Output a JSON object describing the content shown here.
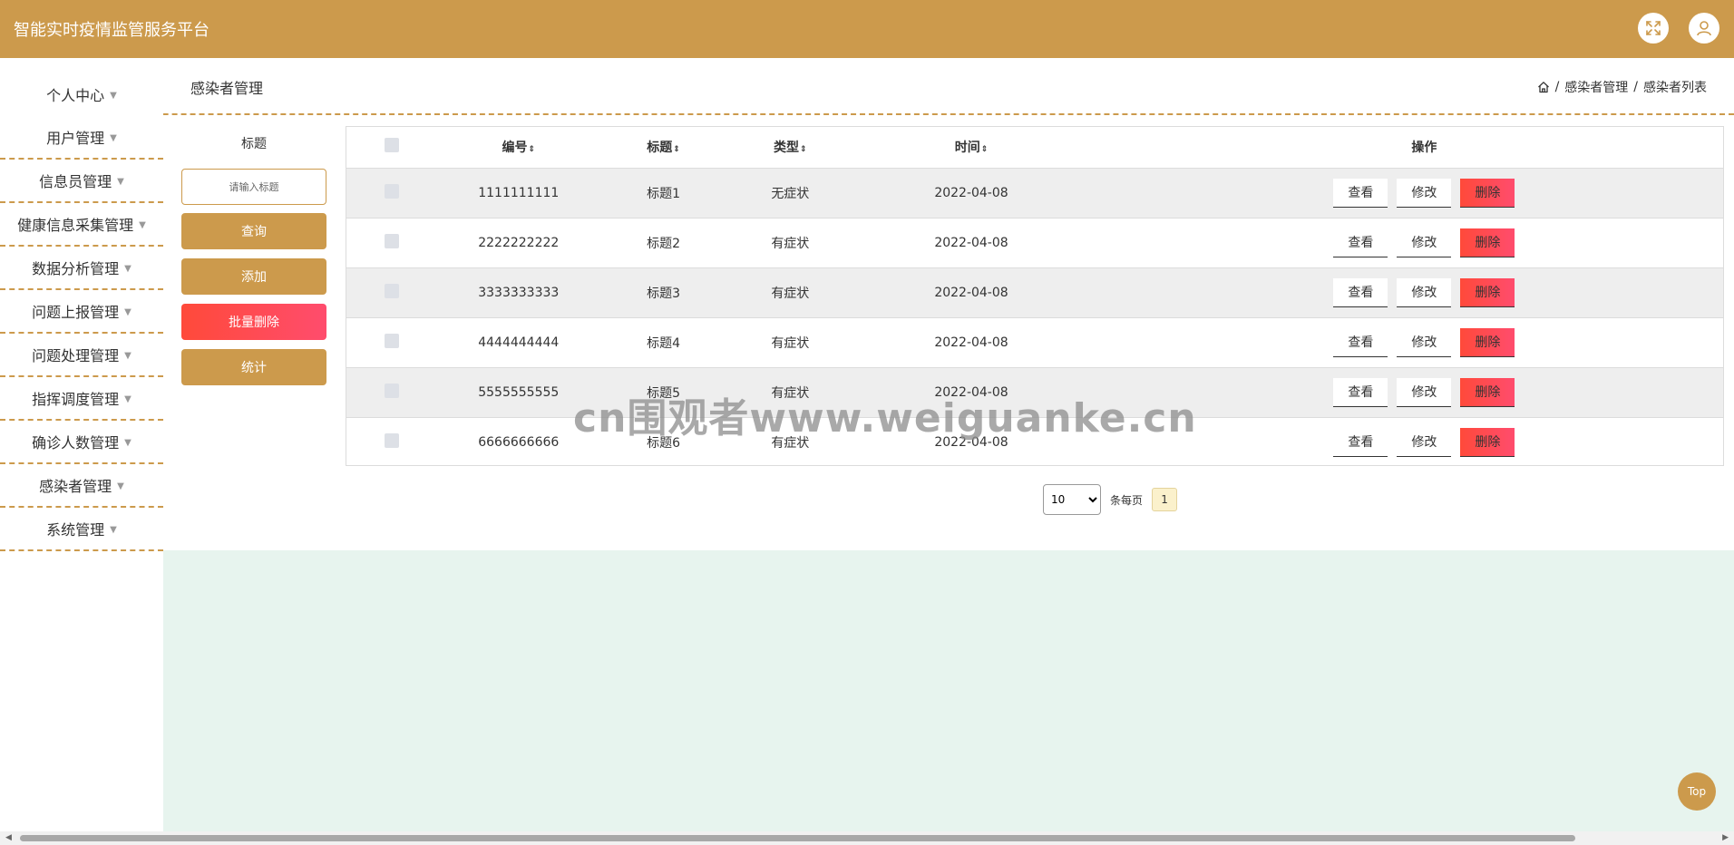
{
  "header": {
    "title": "智能实时疫情监管服务平台",
    "icons": [
      "fullscreen-icon",
      "user-icon"
    ]
  },
  "sidebar": {
    "items": [
      {
        "label": "个人中心"
      },
      {
        "label": "用户管理"
      },
      {
        "label": "信息员管理"
      },
      {
        "label": "健康信息采集管理"
      },
      {
        "label": "数据分析管理"
      },
      {
        "label": "问题上报管理"
      },
      {
        "label": "问题处理管理"
      },
      {
        "label": "指挥调度管理"
      },
      {
        "label": "确诊人数管理"
      },
      {
        "label": "感染者管理"
      },
      {
        "label": "系统管理"
      }
    ]
  },
  "page": {
    "heading": "感染者管理",
    "breadcrumb": [
      "感染者管理",
      "感染者列表"
    ]
  },
  "search": {
    "label": "标题",
    "placeholder": "请输入标题",
    "query_label": "查询",
    "add_label": "添加",
    "batch_delete_label": "批量删除",
    "stats_label": "统计"
  },
  "table": {
    "columns": [
      "编号",
      "标题",
      "类型",
      "时间",
      "操作"
    ],
    "rows": [
      {
        "id": "1111111111",
        "title": "标题1",
        "type": "无症状",
        "time": "2022-04-08"
      },
      {
        "id": "2222222222",
        "title": "标题2",
        "type": "有症状",
        "time": "2022-04-08"
      },
      {
        "id": "3333333333",
        "title": "标题3",
        "type": "有症状",
        "time": "2022-04-08"
      },
      {
        "id": "4444444444",
        "title": "标题4",
        "type": "有症状",
        "time": "2022-04-08"
      },
      {
        "id": "5555555555",
        "title": "标题5",
        "type": "有症状",
        "time": "2022-04-08"
      },
      {
        "id": "6666666666",
        "title": "标题6",
        "type": "有症状",
        "time": "2022-04-08"
      }
    ],
    "actions": {
      "view": "查看",
      "edit": "修改",
      "delete": "删除"
    }
  },
  "pagination": {
    "page_size": "10",
    "per_page_label": "条每页",
    "current_page": "1"
  },
  "watermark": "cn围观者www.weiguanke.cn",
  "top_button": "Top",
  "colors": {
    "accent": "#cc9a4c",
    "danger": "#ff4a3a",
    "content_bg": "#e7f4ee"
  }
}
